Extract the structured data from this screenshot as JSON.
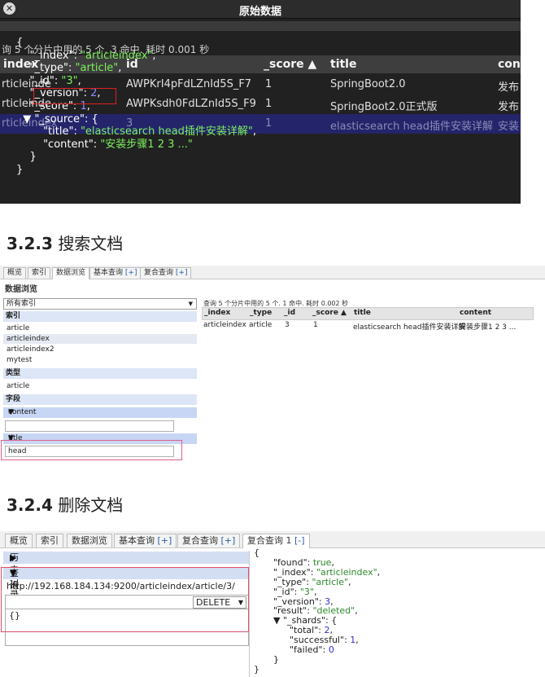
{
  "raw_dialog": {
    "title": "原始数据",
    "close_icon": "close-icon",
    "stats": "询 5 个分片中用的 5 个. 3 命中. 耗时 0.001 秒",
    "columns": [
      "index",
      "id",
      "_score ▲",
      "title",
      "cont"
    ],
    "rows": [
      {
        "index": "rticleindex",
        "id": "3",
        "score": "1",
        "title": "elasticsearch head插件安装详解",
        "content": "安装"
      },
      {
        "index": "rticleinde",
        "id": "AWPKrI4pFdLZnId5S_F7",
        "score": "1",
        "title": "SpringBoot2.0",
        "content": "发布"
      },
      {
        "index": "rticleinde",
        "id": "AWPKsdh0FdLZnId5S_F9",
        "score": "1",
        "title": "SpringBoot2.0正式版",
        "content": "发布"
      }
    ],
    "json": {
      "open": "{",
      "index_key": "\"_index\"",
      "index_val": "\"articleindex\"",
      "type_key": "\"_type\"",
      "type_val": "\"article\"",
      "id_key": "\"_id\"",
      "id_val": "\"3\"",
      "version_key": "\"_version\"",
      "version_val": "2",
      "score_key": "\"_score\"",
      "score_val": "1",
      "source_key": "\"_source\"",
      "title_key": "\"title\"",
      "title_val": "\"elasticsearch head插件安装详解\"",
      "content_key": "\"content\"",
      "content_val": "\"安装步骤1 2 3 ...\"",
      "close": "}"
    }
  },
  "heading_search": {
    "num": "3.2.3",
    "text": "搜索文档"
  },
  "heading_delete": {
    "num": "3.2.4",
    "text": "删除文档"
  },
  "browser": {
    "tabs": [
      {
        "label": "概览"
      },
      {
        "label": "索引"
      },
      {
        "label": "数据浏览"
      },
      {
        "label": "基本查询",
        "plus": "[+]"
      },
      {
        "label": "复合查询",
        "plus": "[+]"
      }
    ],
    "page_title": "数据浏览",
    "index_select": "所有索引",
    "section_index": "索引",
    "indices": [
      "article",
      "articleindex",
      "articleindex2",
      "mytest"
    ],
    "section_type": "类型",
    "types": [
      "article"
    ],
    "section_field": "字段",
    "field_content": "content",
    "field_title": "title",
    "title_value": "head",
    "stats": "查询 5 个分片中用的 5 个. 1 命中. 耗时 0.002 秒",
    "columns": [
      "_index",
      "_type",
      "_id",
      "_score ▲",
      "title",
      "content"
    ],
    "row": {
      "index": "articleindex",
      "type": "article",
      "id": "3",
      "score": "1",
      "title": "elasticsearch head插件安装详解",
      "content": "安装步骤1 2 3 ..."
    }
  },
  "delete_panel": {
    "tabs": [
      {
        "label": "概览"
      },
      {
        "label": "索引"
      },
      {
        "label": "数据浏览"
      },
      {
        "label": "基本查询",
        "plus": "[+]"
      },
      {
        "label": "复合查询",
        "plus": "[+]"
      },
      {
        "label": "复合查询 1",
        "plus": "[-]"
      }
    ],
    "history": "历史记录",
    "query": "查询",
    "url": "http://192.168.184.134:9200/articleindex/article/3/",
    "method": "DELETE",
    "body": "{}",
    "response": [
      {
        "indent": 0,
        "text": "{"
      },
      {
        "indent": 1,
        "key": "\"found\"",
        "val": "true",
        "kind": "s"
      },
      {
        "indent": 1,
        "key": "\"_index\"",
        "val": "\"articleindex\"",
        "kind": "s"
      },
      {
        "indent": 1,
        "key": "\"_type\"",
        "val": "\"article\"",
        "kind": "s"
      },
      {
        "indent": 1,
        "key": "\"_id\"",
        "val": "\"3\"",
        "kind": "s"
      },
      {
        "indent": 1,
        "key": "\"_version\"",
        "val": "3",
        "kind": "n"
      },
      {
        "indent": 1,
        "key": "\"result\"",
        "val": "\"deleted\"",
        "kind": "s"
      },
      {
        "indent": 1,
        "key": "▼ \"_shards\"",
        "val": "{",
        "kind": "o"
      },
      {
        "indent": 2,
        "key": "\"total\"",
        "val": "2",
        "kind": "n"
      },
      {
        "indent": 2,
        "key": "\"successful\"",
        "val": "1",
        "kind": "n"
      },
      {
        "indent": 2,
        "key": "\"failed\"",
        "val": "0",
        "kind": "n"
      },
      {
        "indent": 1,
        "text": "}"
      },
      {
        "indent": 0,
        "text": "}"
      }
    ]
  }
}
